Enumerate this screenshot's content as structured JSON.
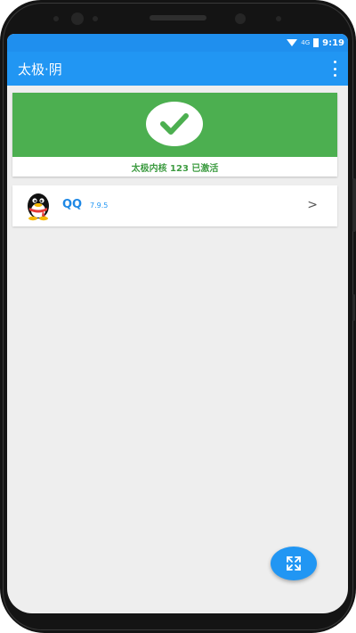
{
  "status_bar": {
    "time": "9:19",
    "signal": "4G"
  },
  "app_bar": {
    "title": "太极·阴",
    "menu_icon": "more-vert-icon"
  },
  "status_card": {
    "icon": "check-circle-icon",
    "text": "太极内核 123 已激活",
    "color": "#4caf50"
  },
  "modules": [
    {
      "name": "QQ",
      "version": "7.9.5",
      "icon": "qq-penguin-icon"
    }
  ],
  "fab": {
    "icon": "expand-icon"
  },
  "colors": {
    "primary": "#2196f3",
    "success": "#4caf50"
  }
}
